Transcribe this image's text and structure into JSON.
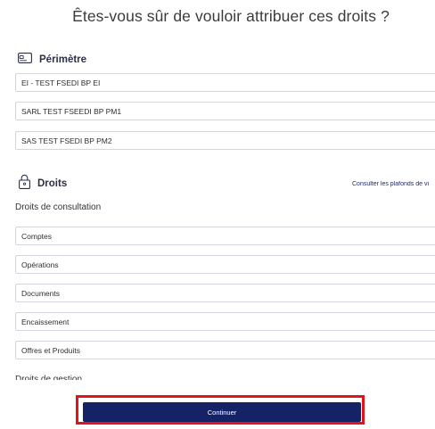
{
  "dialog": {
    "title": "Êtes-vous sûr de vouloir attribuer ces droits ?"
  },
  "perimetre": {
    "heading": "Périmètre",
    "icon": "card-icon",
    "items": [
      "EI - TEST FSEDI BP EI",
      "SARL TEST FSEEDI BP PM1",
      "SAS TEST FSEDI BP PM2"
    ]
  },
  "droits": {
    "heading": "Droits",
    "icon": "lock-icon",
    "link": "Consulter les plafonds de vi",
    "consultation_heading": "Droits de consultation",
    "consultation_items": [
      "Comptes",
      "Opérations",
      "Documents",
      "Encaissement",
      "Offres et Produits"
    ],
    "gestion_heading": "Droits de gestion"
  },
  "actions": {
    "continue_label": "Continuer"
  },
  "colors": {
    "primary": "#152366",
    "highlight": "#e2131b",
    "border": "#d4d6dc"
  }
}
